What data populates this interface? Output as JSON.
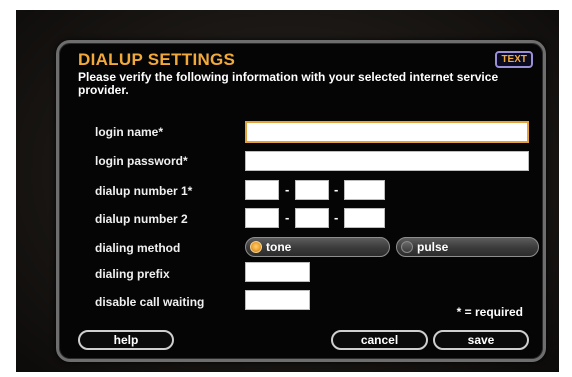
{
  "dialog": {
    "title": "DIALUP SETTINGS",
    "text_button": "TEXT",
    "subtitle": "Please verify the following information with your selected internet service provider."
  },
  "form": {
    "login_name_label": "login name*",
    "login_name_value": "",
    "login_password_label": "login password*",
    "login_password_value": "",
    "dialup1_label": "dialup number 1*",
    "dialup1_parts": [
      "",
      "",
      ""
    ],
    "dialup2_label": "dialup number 2",
    "dialup2_parts": [
      "",
      "",
      ""
    ],
    "separator": "-",
    "dialing_method_label": "dialing method",
    "dialing_methods": [
      {
        "label": "tone",
        "selected": true
      },
      {
        "label": "pulse",
        "selected": false
      }
    ],
    "dialing_prefix_label": "dialing prefix",
    "dialing_prefix_value": "",
    "disable_call_waiting_label": "disable call waiting",
    "disable_call_waiting_value": "",
    "required_note": "* = required"
  },
  "buttons": {
    "help": "help",
    "cancel": "cancel",
    "save": "save"
  },
  "colors": {
    "title": "#f2a93b",
    "focus_border": "#e3a23c",
    "panel_border": "#6e6e6e"
  }
}
